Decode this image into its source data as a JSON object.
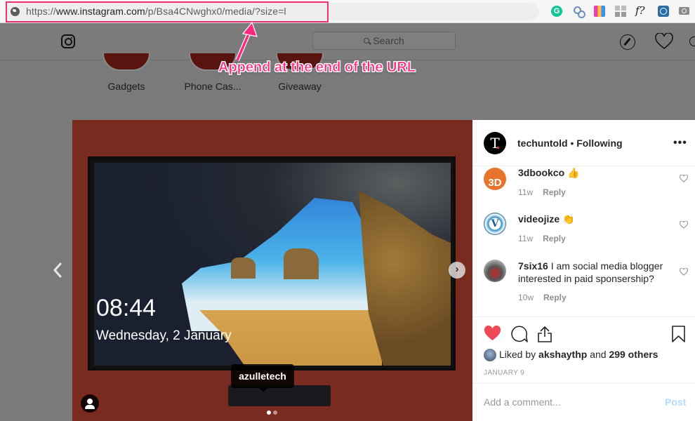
{
  "browser": {
    "url_prefix": "https://",
    "url_host": "www.instagram.com",
    "url_path": "/p/Bsa4CNwghx0/media/?size=l",
    "extensions": [
      "grammarly-icon",
      "link-icon",
      "color-picker-icon",
      "grid-icon",
      "font-identifier-icon",
      "safari-compass-icon",
      "camera-icon"
    ],
    "grammarly_glyph": "G",
    "font_ext_glyph": "f?"
  },
  "header": {
    "search_placeholder": "Search"
  },
  "highlights": [
    {
      "label": "Gadgets"
    },
    {
      "label": "Phone Cas..."
    },
    {
      "label": "Giveaway"
    }
  ],
  "annotation": {
    "text": "Append at the end of the URL",
    "color": "#ff2a7d"
  },
  "photo": {
    "lock_time": "08:44",
    "lock_date": "Wednesday, 2 January",
    "user_tag": "azulletech",
    "carousel_total": 2,
    "carousel_current": 1,
    "next_glyph": "›"
  },
  "post": {
    "owner": "techuntold",
    "separator": "•",
    "follow_status": "Following",
    "owner_avatar_letter": "T",
    "more_glyph": "•••",
    "comments": [
      {
        "user": "3dbookco",
        "text": "👍",
        "age": "11w",
        "reply": "Reply",
        "avatar_text": "3D"
      },
      {
        "user": "videojize",
        "text": "👏",
        "age": "11w",
        "reply": "Reply",
        "avatar_text": "V"
      },
      {
        "user": "7six16",
        "text": "I am social media blogger interested in paid sponsership?",
        "age": "10w",
        "reply": "Reply",
        "avatar_text": ""
      }
    ],
    "liked_by_prefix": "Liked by",
    "liked_by_user": "akshaythp",
    "liked_by_suffix": "and",
    "liked_others": "299 others",
    "date": "JANUARY 9",
    "comment_placeholder": "Add a comment...",
    "post_label": "Post",
    "like_color": "#ed4956"
  }
}
